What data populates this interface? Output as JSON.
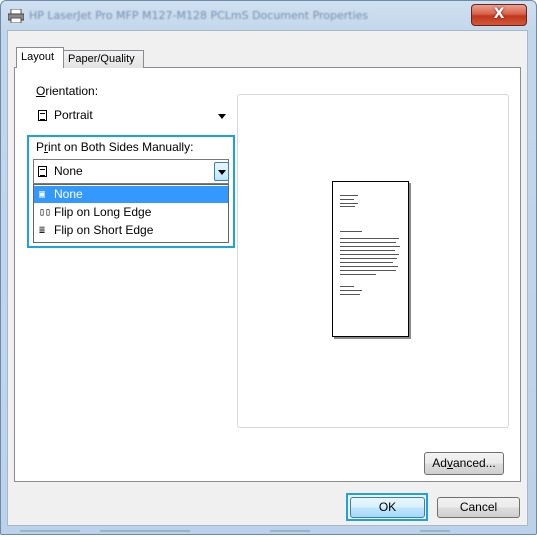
{
  "window": {
    "title": "HP LaserJet Pro MFP M127-M128 PCLmS Document Properties",
    "close_label": "X",
    "colors": {
      "highlight": "#1ba3dc",
      "selection": "#3399ff",
      "close": "#c8442a"
    }
  },
  "tabs": [
    {
      "label": "Layout",
      "active": true
    },
    {
      "label": "Paper/Quality",
      "active": false
    }
  ],
  "orientation": {
    "label_first": "O",
    "label_rest": "rientation:",
    "value": "Portrait",
    "icon": "portrait-page-icon"
  },
  "duplex": {
    "label_pre": "P",
    "label_u": "r",
    "label_post": "int on Both Sides Manually:",
    "value": "None",
    "options": [
      {
        "label": "None",
        "icon": "single-page-icon",
        "selected": true
      },
      {
        "label": "Flip on Long Edge",
        "icon": "book-long-edge-icon",
        "selected": false
      },
      {
        "label": "Flip on Short Edge",
        "icon": "calendar-short-edge-icon",
        "selected": false
      }
    ]
  },
  "buttons": {
    "advanced_pre": "Ad",
    "advanced_u": "v",
    "advanced_post": "anced...",
    "ok": "OK",
    "cancel": "Cancel"
  }
}
